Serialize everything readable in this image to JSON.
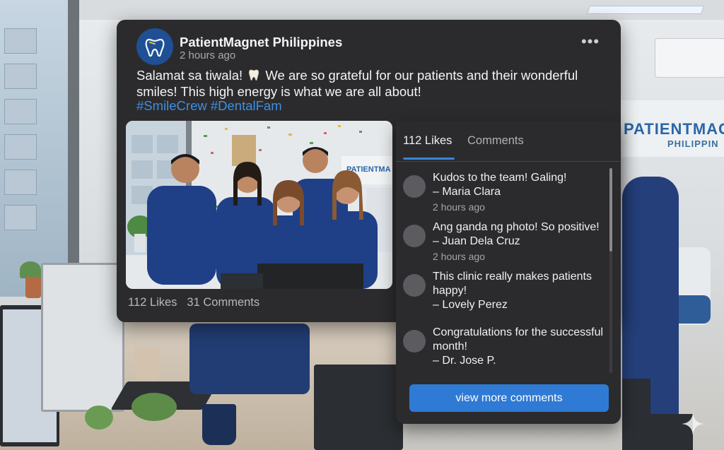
{
  "post": {
    "page_name": "PatientMagnet Philippines",
    "time": "2 hours ago",
    "text_part1": "Salamat sa tiwala!",
    "text_emoji": "tooth-emoji",
    "text_part2": "We are so grateful for our patients and their wonderful smiles! This high energy is what we are all about!",
    "hashtags": [
      "#SmileCrew",
      "#DentalFam"
    ],
    "more_label": "•••",
    "likes": "112 Likes",
    "comments": "31 Comments",
    "photo_sign_text": "PATIENTMA"
  },
  "background": {
    "brand_line1": "PATIENTMAG",
    "brand_line2": "PHILIPPIN"
  },
  "panel": {
    "tabs": [
      {
        "label": "112 Likes",
        "active": true
      },
      {
        "label": "Comments",
        "active": false
      }
    ],
    "comments": [
      {
        "text": "Kudos to the team! Galing!",
        "author": "– Maria Clara",
        "time": "2 hours ago"
      },
      {
        "text": "Ang ganda ng photo! So positive!",
        "author": "– Juan Dela Cruz",
        "time": "2 hours ago"
      },
      {
        "text": "This clinic really makes patients happy!",
        "author": "– Lovely Perez",
        "time": ""
      },
      {
        "text": "Congratulations for the successful month!",
        "author": "– Dr. Jose P.",
        "time": ""
      }
    ],
    "view_more_label": "view more comments"
  },
  "colors": {
    "card_bg": "#2b2b2d",
    "accent": "#2f7ad4",
    "hashtag": "#3e8ee4",
    "scrub_blue": "#1f3f86"
  }
}
